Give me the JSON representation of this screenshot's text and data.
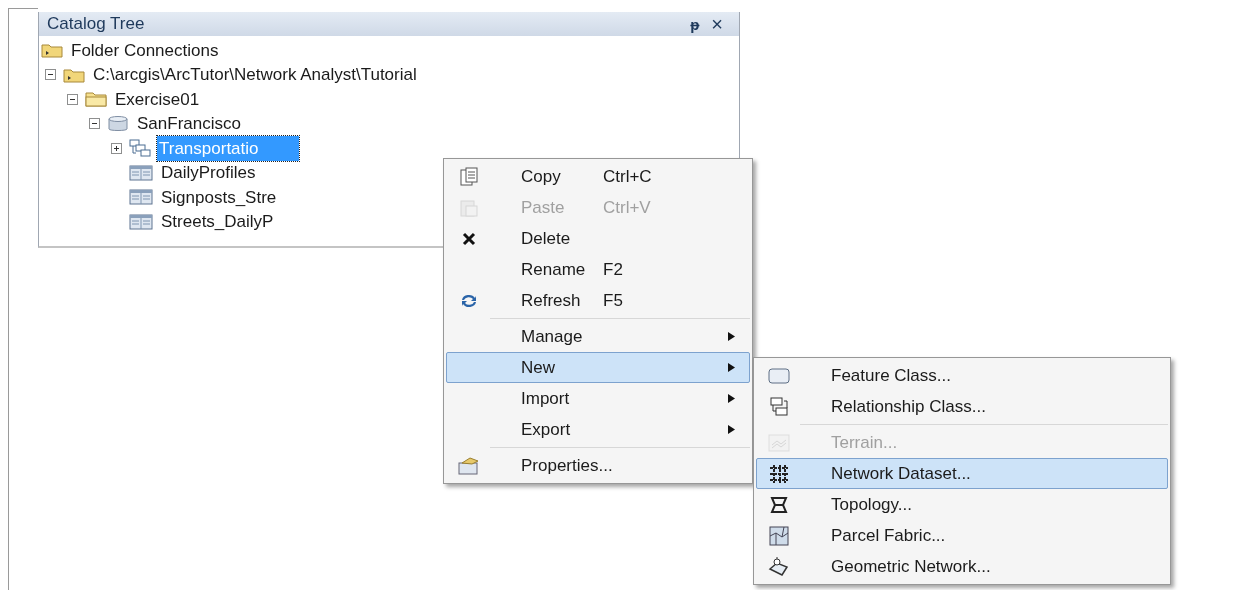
{
  "panel": {
    "title": "Catalog Tree",
    "pin": "ᵽ",
    "close": "×"
  },
  "tree": [
    {
      "label": "Folder Connections",
      "kind": "folder-connection",
      "selected": false,
      "children": [
        {
          "label": "C:\\arcgis\\ArcTutor\\Network Analyst\\Tutorial",
          "kind": "folder-connection",
          "expanded": true,
          "selected": false,
          "children": [
            {
              "label": "Exercise01",
              "kind": "folder",
              "expanded": true,
              "selected": false,
              "children": [
                {
                  "label": "SanFrancisco",
                  "kind": "geodatabase",
                  "expanded": true,
                  "selected": false,
                  "children": [
                    {
                      "label": "Transportatio",
                      "kind": "feature-dataset",
                      "expanded": false,
                      "selected": true
                    },
                    {
                      "label": "DailyProfiles",
                      "kind": "table",
                      "selected": false
                    },
                    {
                      "label": "Signposts_Stre",
                      "kind": "table",
                      "selected": false
                    },
                    {
                      "label": "Streets_DailyP",
                      "kind": "table",
                      "selected": false
                    }
                  ]
                }
              ]
            }
          ]
        }
      ]
    }
  ],
  "context_menu": {
    "groups": [
      [
        {
          "label": "Copy",
          "shortcut": "Ctrl+C",
          "disabled": false,
          "selected": false,
          "submenu": false
        },
        {
          "label": "Paste",
          "shortcut": "Ctrl+V",
          "disabled": true,
          "selected": false,
          "submenu": false
        },
        {
          "label": "Delete",
          "disabled": false,
          "selected": false,
          "submenu": false
        },
        {
          "label": "Rename",
          "shortcut": "F2",
          "disabled": false,
          "selected": false,
          "submenu": false
        },
        {
          "label": "Refresh",
          "shortcut": "F5",
          "disabled": false,
          "selected": false,
          "submenu": false
        }
      ],
      [
        {
          "label": "Manage",
          "disabled": false,
          "selected": false,
          "submenu": true
        },
        {
          "label": "New",
          "disabled": false,
          "selected": true,
          "submenu": true
        },
        {
          "label": "Import",
          "disabled": false,
          "selected": false,
          "submenu": true
        },
        {
          "label": "Export",
          "disabled": false,
          "selected": false,
          "submenu": true
        }
      ],
      [
        {
          "label": "Properties...",
          "disabled": false,
          "selected": false,
          "submenu": false
        }
      ]
    ]
  },
  "submenu": {
    "groups": [
      [
        {
          "label": "Feature Class...",
          "disabled": false,
          "selected": false
        },
        {
          "label": "Relationship Class...",
          "disabled": false,
          "selected": false
        }
      ],
      [
        {
          "label": "Terrain...",
          "disabled": true,
          "selected": false
        },
        {
          "label": "Network Dataset...",
          "disabled": false,
          "selected": true
        },
        {
          "label": "Topology...",
          "disabled": false,
          "selected": false
        },
        {
          "label": "Parcel Fabric...",
          "disabled": false,
          "selected": false
        },
        {
          "label": "Geometric Network...",
          "disabled": false,
          "selected": false
        }
      ]
    ]
  }
}
